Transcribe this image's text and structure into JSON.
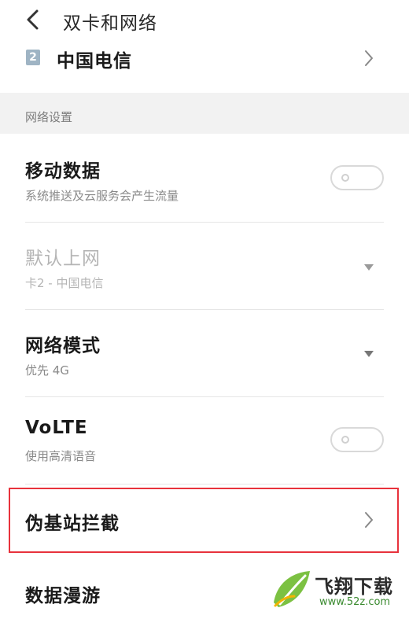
{
  "header": {
    "title": "双卡和网络"
  },
  "sim": {
    "badge": "2",
    "name": "中国电信"
  },
  "section": {
    "label": "网络设置"
  },
  "settings": [
    {
      "title": "移动数据",
      "subtitle": "系统推送及云服务会产生流量",
      "control": "toggle",
      "state": "off",
      "enabled": true
    },
    {
      "title": "默认上网",
      "subtitle": "卡2 - 中国电信",
      "control": "dropdown",
      "enabled": false
    },
    {
      "title": "网络模式",
      "subtitle": "优先 4G",
      "control": "dropdown",
      "enabled": true
    },
    {
      "title": "VoLTE",
      "subtitle": "使用高清语音",
      "control": "toggle",
      "state": "off",
      "enabled": true
    },
    {
      "title": "伪基站拦截",
      "control": "chevron",
      "enabled": true,
      "highlighted": true
    },
    {
      "title": "数据漫游",
      "enabled": true
    }
  ],
  "watermark": {
    "brand": "飞翔下载",
    "url": "www.52z.com"
  },
  "colors": {
    "highlight": "#e8323c",
    "section_bg": "#f2f2f2",
    "sim_badge": "#9fb4c4",
    "watermark_green": "#3a8a2f"
  }
}
